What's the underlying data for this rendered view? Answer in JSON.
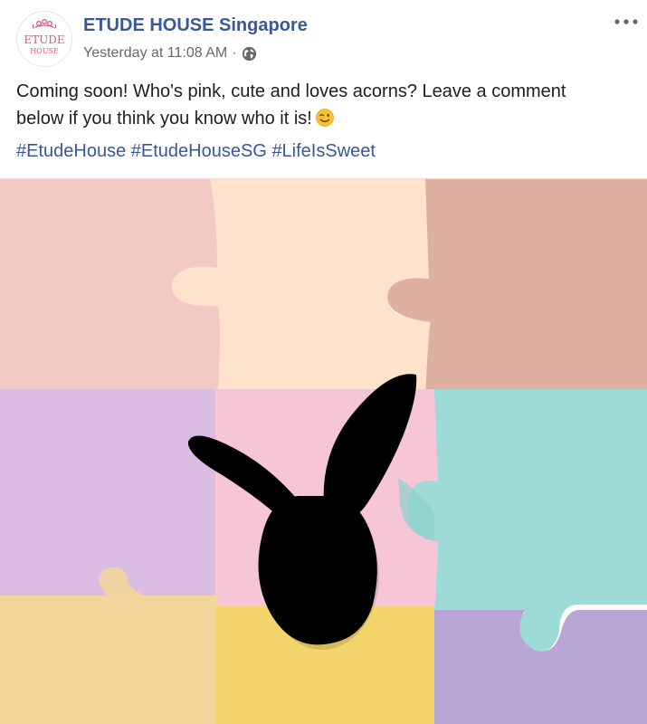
{
  "post": {
    "page_name": "ETUDE HOUSE Singapore",
    "timestamp": "Yesterday at 11:08 AM",
    "separator": "·",
    "privacy_icon": "globe-icon",
    "more_icon": "more-options-icon",
    "avatar": {
      "logo_line1": "ETUDE",
      "logo_line2": "HOUSE",
      "logo_color": "#e05583"
    },
    "message_line1": "Coming soon! Who's pink, cute and loves acorns? Leave a comment",
    "message_line2": "below if you think you know who it is!",
    "emoji": "winking-face-emoji",
    "hashtags": [
      "#EtudeHouse",
      "#EtudeHouseSG",
      "#LifeIsSweet"
    ],
    "photo": {
      "description_icon": "silhouette-bunny-image",
      "colors": {
        "pink": "#f3c9c6",
        "peach": "#fde3cb",
        "rose": "#ddb0a0",
        "lilac": "#dbbde3",
        "hot_pink": "#f6c6d6",
        "teal": "#9fdbd6",
        "sand": "#f1d59b",
        "yellow": "#f2d46a",
        "purple": "#b7a5d4"
      }
    }
  }
}
